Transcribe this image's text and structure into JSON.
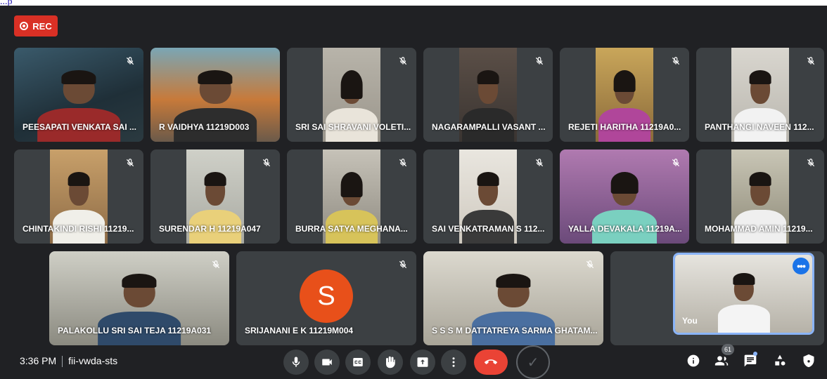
{
  "top_link": "...p",
  "rec_label": "REC",
  "participants": [
    {
      "name": "PEESAPATI VENKATA SAI ...",
      "muted": true
    },
    {
      "name": "R VAIDHYA 11219D003",
      "muted": false
    },
    {
      "name": "SRI SAI SHRAVANI VOLETI...",
      "muted": true
    },
    {
      "name": "NAGARAMPALLI VASANT ...",
      "muted": true
    },
    {
      "name": "REJETI HARITHA 11219A0...",
      "muted": true
    },
    {
      "name": "PANTHANGI NAVEEN 112...",
      "muted": true
    },
    {
      "name": "CHINTAKINDI RISHI 11219...",
      "muted": true
    },
    {
      "name": "SURENDAR H 11219A047",
      "muted": true
    },
    {
      "name": "BURRA SATYA MEGHANA...",
      "muted": true
    },
    {
      "name": "SAI VENKATRAMAN S 112...",
      "muted": true
    },
    {
      "name": "YALLA DEVAKALA 11219A...",
      "muted": true
    },
    {
      "name": "MOHAMMAD AMIN 11219...",
      "muted": true
    },
    {
      "name": "PALAKOLLU SRI SAI TEJA 11219A031",
      "muted": true
    },
    {
      "name": "SRIJANANI E K 11219M004",
      "muted": true,
      "avatar_letter": "S"
    },
    {
      "name": "S S S M DATTATREYA SARMA GHATAM...",
      "muted": true
    }
  ],
  "self_tile": {
    "label": "You",
    "more": "•••"
  },
  "bottom_bar": {
    "time": "3:36 PM",
    "meeting_code": "fii-vwda-sts",
    "people_count": "61"
  },
  "colors": {
    "background": "#202124",
    "tile": "#3c4043",
    "rec": "#d93025",
    "hangup": "#ea4335",
    "accent": "#8ab4f8",
    "avatar": "#e8501a"
  }
}
